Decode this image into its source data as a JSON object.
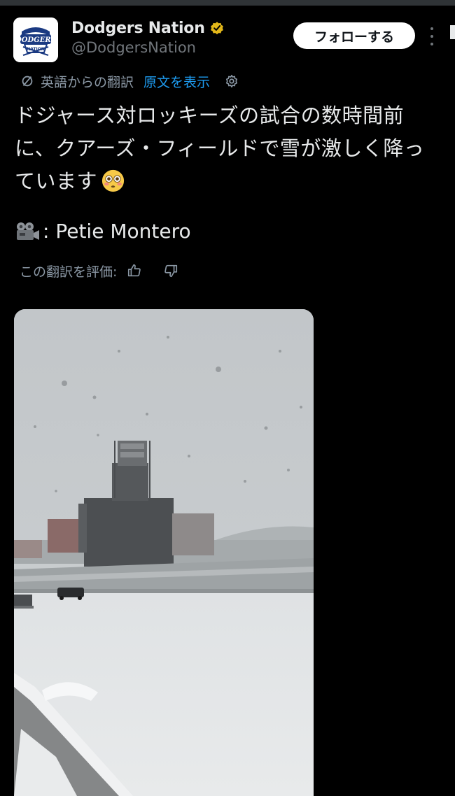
{
  "tweet": {
    "author": {
      "display_name": "Dodgers Nation",
      "handle": "@DodgersNation",
      "verified": true,
      "avatar_icon": "dodgers-nation-logo"
    },
    "follow_label": "フォローする",
    "translation": {
      "from_label": "英語からの翻訳",
      "show_original_label": "原文を表示"
    },
    "text_lines": [
      "ドジャース対ロッキーズの試合の数時間前",
      "に、クアーズ・フィールドで雪が激しく降っ",
      "ています"
    ],
    "emoji": "flushed-face-emoji",
    "credit_text": ": Petie Montero",
    "rate_label": "この翻訳を評価:",
    "media": {
      "type": "video-still",
      "description_icon": "snowy-stadium-image"
    }
  },
  "colors": {
    "background": "#000000",
    "text_primary": "#e7e9ea",
    "text_secondary": "#71767b",
    "link": "#1d9bf0",
    "verified_badge": "#e2b719",
    "follow_button_bg": "#ffffff"
  }
}
